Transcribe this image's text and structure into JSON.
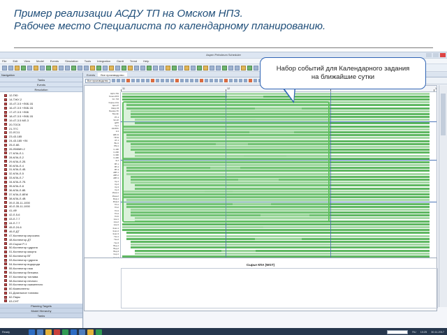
{
  "slide": {
    "title_line1": "Пример реализации АСДУ ТП на Омском НПЗ.",
    "title_line2": "Рабочее место Специалиста по календарному планированию."
  },
  "callout": {
    "line1": "Набор событий для Календарного задания",
    "line2": "на ближайшие сутки"
  },
  "app": {
    "window_title": "Aspen Petroleum Scheduler",
    "menu": [
      "File",
      "Edit",
      "View",
      "Model",
      "Events",
      "Simulation",
      "Tools",
      "Integration",
      "Gantt",
      "Trend",
      "Help"
    ],
    "nav": {
      "header": "Navigation",
      "sections_top": [
        "Tanks",
        "Events",
        "Resolution"
      ],
      "items": [
        "12-ПЮ",
        "14-ТЖУ-2",
        "15-4Т-3.5 +Л6Б.1Б",
        "16-4Т-3.5 +Л6Б.1Б",
        "17-4Т-3.5 +Л6Б",
        "18-4Т-3.5 +Л6Б.1Б",
        "19-4Т-3.5 МЛ-3",
        "20-ТОСК",
        "21-ТГС",
        "22-ЛС11",
        "23-43-185",
        "24-43-185 +Л6",
        "25-Л-6Б",
        "26-Л6КМН-2",
        "27-КЛА-Л-1",
        "28-КЛА-Л-2",
        "29-КЛА-Л-2Б",
        "30-КЛА-Л-4",
        "31-КЛА-Л-4Б",
        "32-КЛА-Л-5",
        "33-КЛА-Л-7",
        "34-КЛА-Л-7Б",
        "35-КЛА-Л-8",
        "36-КЛА-Л-8Б",
        "37-КЛА-Л-8ЕМ",
        "38-КЛА-Л-4В",
        "39-Л-35-11-1000",
        "40-Л-35-11-1000",
        "41-4Ф",
        "42-Л-5-6",
        "43-Л-7-7",
        "44-Л-7-7",
        "45-Л-24-6",
        "46-Л-ДТ",
        "47-Коллектор керосина",
        "48-Коллектор ДТ",
        "49-Сырье Р-1",
        "50-Коллектор гудрона",
        "51-Коллектор мазута",
        "52-Коллектор ВГ",
        "53-Коллектор гудрона",
        "54-Коллектор водорода",
        "55-Коллектор газа",
        "56-Коллектор бензина",
        "57-Коллектор топлива",
        "58-Коллектор печного",
        "59-Коллектор сжиженного",
        "60-Компоненты",
        "61-Дизельное топливо",
        "62-Пары",
        "63-СНТ",
        "64-Коллектор сырья",
        "65-ЗЛОЗ",
        "66-Бензины",
        "67-ГСК (уст. сернистого бензина)"
      ],
      "sections_bottom": [
        "Planning Targets",
        "Model Hierarchy",
        "Tanks"
      ]
    },
    "tabs": [
      "Events",
      "Все производство"
    ],
    "filter_value": "Все производство",
    "timeline_ticks": [
      "11",
      "12",
      "13",
      "14"
    ],
    "event_labels": [
      "ЦМ-1 ПН",
      "Гилеп-РС5",
      "Уст. ТМ",
      "Сырье-Атм",
      "Цех-27",
      "Мазут-В",
      "Бензин-ТК",
      "Бен-Кр",
      "РТ-4",
      "ЧК-1Л",
      "ЦРП",
      "Ур-1",
      "КЭ-5ЛС",
      "К-3",
      "ЦМ-11",
      "ПП-9",
      "АТ-1",
      "БН-1",
      "РМ-1",
      "С-100",
      "С-200",
      "С-300",
      "С-400",
      "Е-2",
      "ВТ-1",
      "ВТ-2",
      "ВТ-3",
      "АВТ-1",
      "АВТ-2",
      "АВТ-3",
      "Кр-1",
      "Кр-2",
      "Кр-3",
      "Кр-4",
      "Изом-1",
      "Изом-2",
      "Риф-1",
      "Риф-2",
      "ГО-1",
      "ГО-2",
      "ГО-3",
      "ГО-4",
      "ГО-5",
      "Алк-1",
      "Алк-2",
      "Алк-3",
      "Кокс-1",
      "Кокс-2",
      "Кокс-3",
      "Газ-1",
      "Газ-2",
      "Газ-3",
      "Вод-1",
      "Вод-2",
      "Вод-3",
      "Сер-1",
      "Сер-2"
    ],
    "lower_labels": [
      "DMT мод-1",
      "Выпуск кокса",
      "Остатки с ГС",
      "Компонент нагрузки",
      "Компонент бензина",
      "Компонент керосина",
      "Компонент сжигания"
    ],
    "axis_ticks": [
      "12",
      "13",
      "14"
    ],
    "chart_title": "Сырье КПА (WGT)",
    "status": {
      "text": "Ready",
      "lang": "RU",
      "time": "10:25",
      "date": "30.11.2017"
    }
  }
}
